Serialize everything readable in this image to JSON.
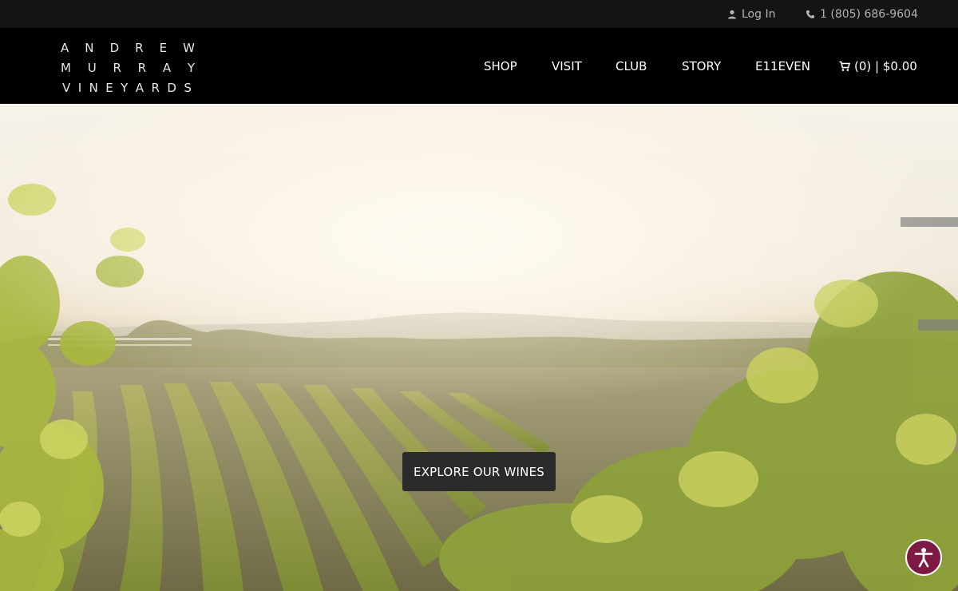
{
  "utility_bar": {
    "login_label": "Log In",
    "login_icon": "user-icon",
    "phone_label": "1 (805) 686-9604",
    "phone_icon": "phone-icon"
  },
  "brand": {
    "logo_lines": [
      "ANDREW",
      "MURRAY",
      "VINEYARDS"
    ]
  },
  "nav": {
    "items": [
      "SHOP",
      "VISIT",
      "CLUB",
      "STORY",
      "E11EVEN"
    ],
    "cart_label": "(0) | $0.00",
    "cart_icon": "cart-icon"
  },
  "hero": {
    "cta_label": "EXPLORE OUR WINES"
  },
  "accessibility": {
    "icon": "accessibility-icon",
    "color": "#7d1a43"
  },
  "colors": {
    "topbar_bg": "#141414",
    "navbar_bg": "#000000",
    "cta_bg": "#2b2b2b"
  }
}
